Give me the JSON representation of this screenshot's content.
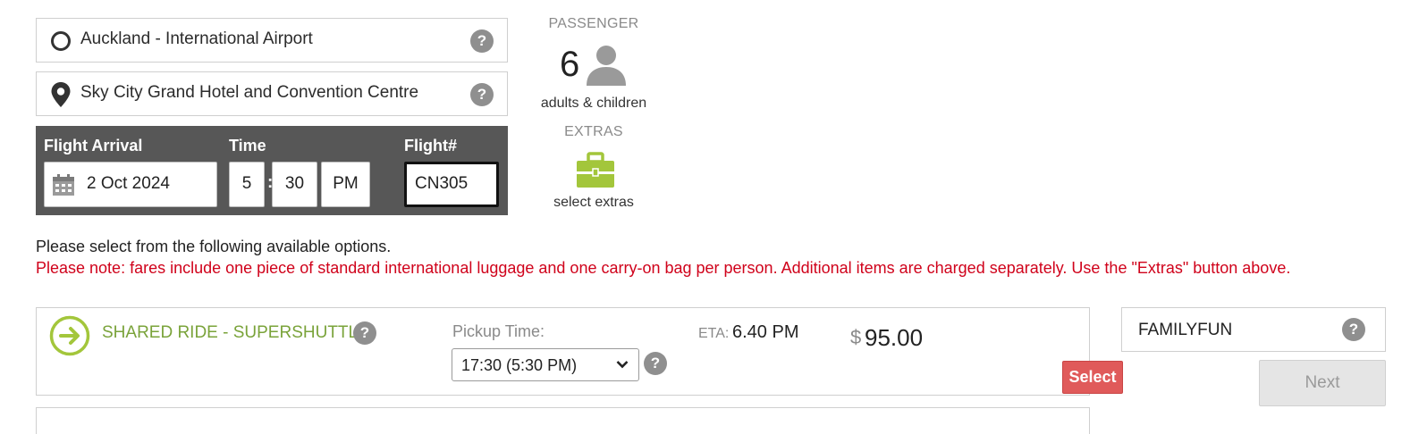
{
  "locations": {
    "pickup": {
      "text": "Auckland - International Airport",
      "icon": "circle-icon",
      "help": "?"
    },
    "dropoff": {
      "text": "Sky City Grand Hotel and Convention Centre",
      "icon": "map-pin-icon",
      "help": "?"
    }
  },
  "flight": {
    "arrival_label": "Flight Arrival",
    "time_label": "Time",
    "flight_label": "Flight#",
    "date_value": "2 Oct 2024",
    "hour": "5",
    "separator": ":",
    "minute": "30",
    "ampm": "PM",
    "flight_number": "CN305"
  },
  "passenger": {
    "heading": "PASSENGER",
    "count": "6",
    "sublabel": "adults & children",
    "icon": "person-icon"
  },
  "extras": {
    "heading": "EXTRAS",
    "sublabel": "select extras",
    "icon": "briefcase-icon",
    "color": "#a3c63b"
  },
  "info": {
    "instruction": "Please select from the following available options.",
    "note": "Please note: fares include one piece of standard international luggage and one carry-on bag per person. Additional items are charged separately. Use the \"Extras\" button above."
  },
  "option": {
    "name": "SHARED RIDE - SUPERSHUTTLE",
    "name_color": "#7aa33a",
    "help": "?",
    "pickup_label": "Pickup Time:",
    "pickup_value": "17:30 (5:30 PM)",
    "eta_label": "ETA:",
    "eta_value": "6.40 PM",
    "currency": "$",
    "price": "95.00",
    "select_label": "Select",
    "select_color": "#e05a5a"
  },
  "promo": {
    "code": "FAMILYFUN",
    "help": "?"
  },
  "next_label": "Next"
}
